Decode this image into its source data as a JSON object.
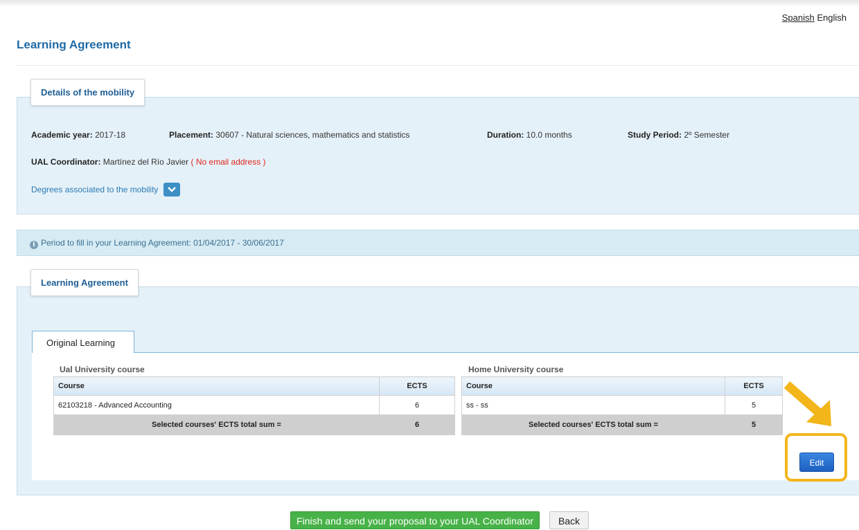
{
  "lang": {
    "spanish": "Spanish",
    "english": "English"
  },
  "page_title": "Learning Agreement",
  "details": {
    "tab_label": "Details of the mobility",
    "academic_year_label": "Academic year:",
    "academic_year": "2017-18",
    "placement_label": "Placement:",
    "placement": "30607 - Natural sciences, mathematics and statistics",
    "duration_label": "Duration:",
    "duration": "10.0 months",
    "study_period_label": "Study Period:",
    "study_period": "2º Semester",
    "coordinator_label": "UAL Coordinator:",
    "coordinator": "Martínez del Río Javier",
    "no_email": "( No email address )",
    "degrees_link": "Degrees associated to the mobility"
  },
  "info": {
    "period_text": "Period to fill in your Learning Agreement: 01/04/2017 - 30/06/2017"
  },
  "agreement": {
    "tab_label": "Learning Agreement",
    "subtab_label": "Original Learning",
    "ual_table": {
      "caption": "Ual University course",
      "headers": [
        "Course",
        "ECTS"
      ],
      "rows": [
        [
          "62103218 - Advanced Accounting",
          "6"
        ]
      ],
      "total_label": "Selected courses' ECTS total sum =",
      "total": "6"
    },
    "home_table": {
      "caption": "Home University course",
      "headers": [
        "Course",
        "ECTS"
      ],
      "rows": [
        [
          "ss - ss",
          "5"
        ]
      ],
      "total_label": "Selected courses' ECTS total sum =",
      "total": "5"
    },
    "edit_label": "Edit"
  },
  "footer": {
    "finish_label": "Finish and send your proposal to your UAL Coordinator",
    "back_label": "Back"
  },
  "colors": {
    "accent": "#1f6aa5",
    "panel_bg": "#e5f1f8",
    "highlight": "#f2b51a",
    "finish": "#47b247",
    "edit": "#1d5fc0"
  }
}
